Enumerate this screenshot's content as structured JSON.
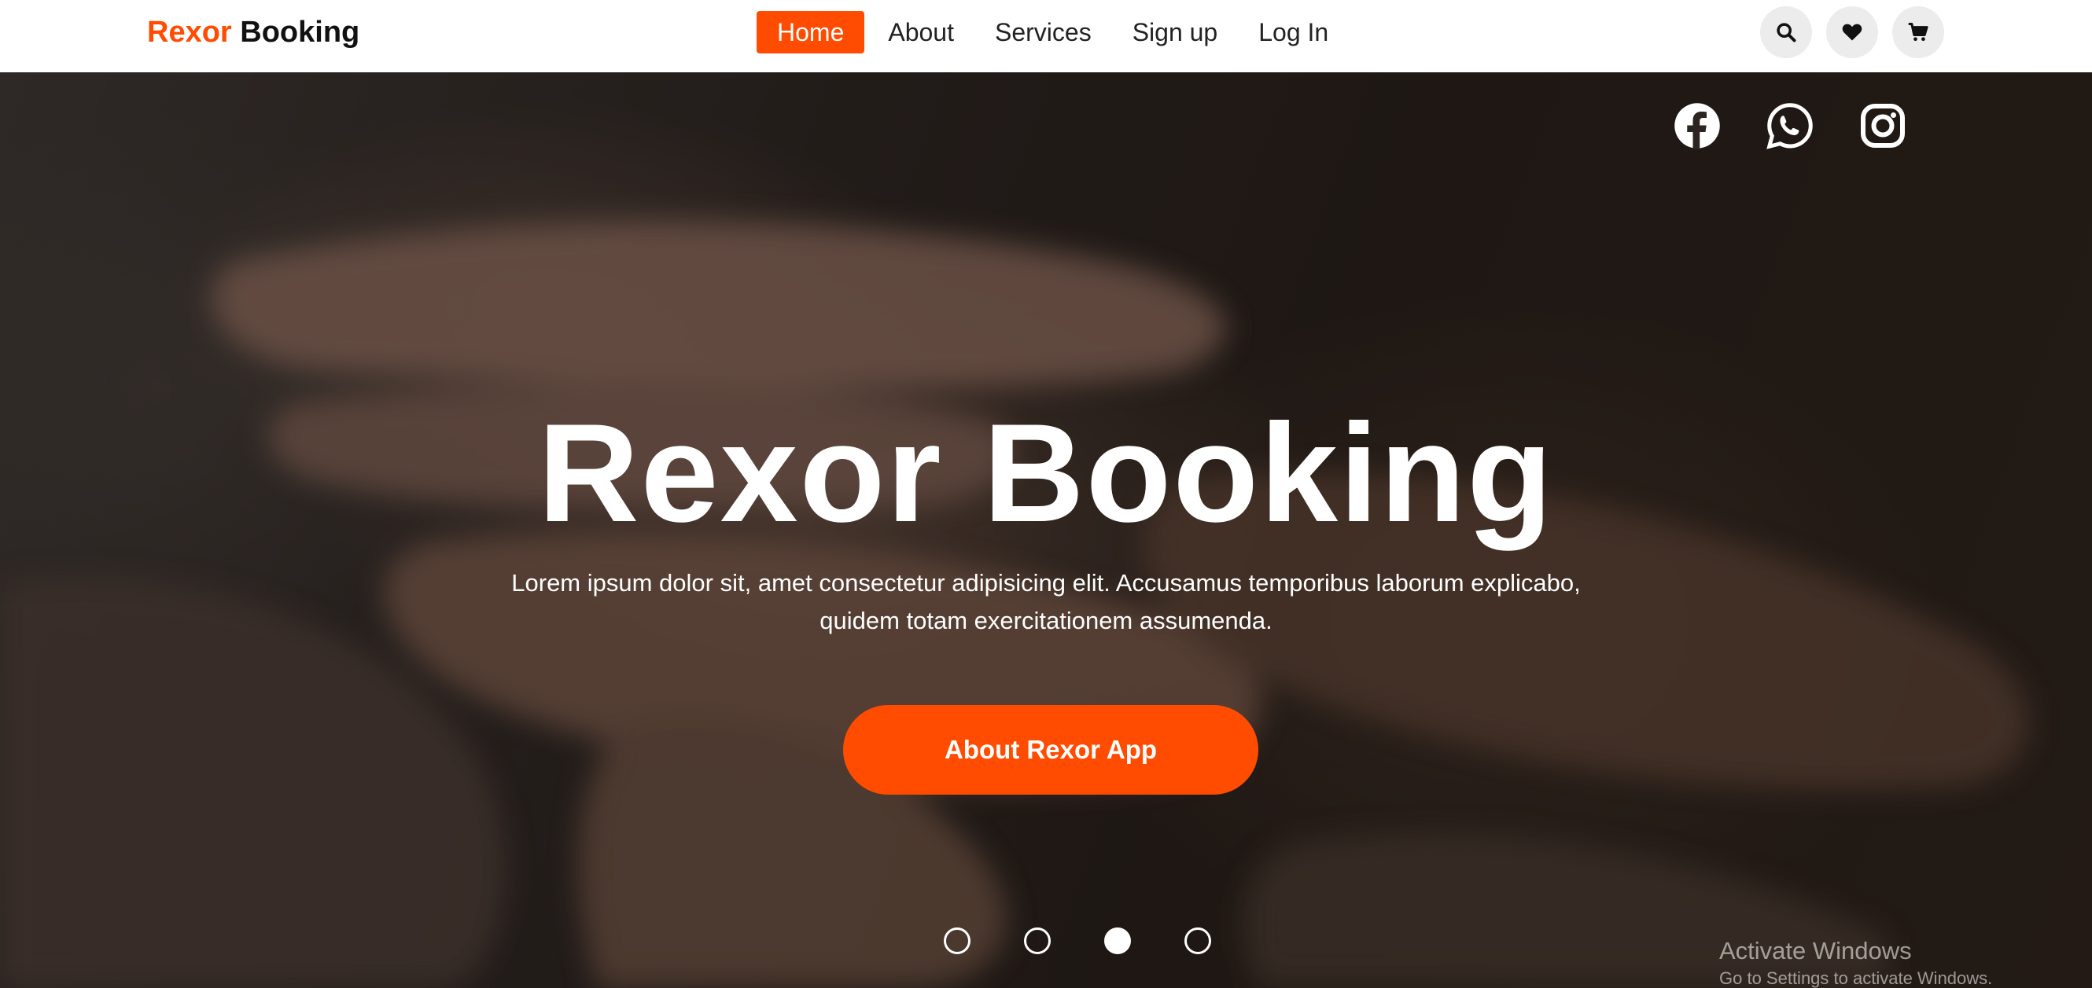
{
  "brand": {
    "accent": "Rexor",
    "rest": "Booking"
  },
  "nav": {
    "items": [
      {
        "label": "Home",
        "active": true
      },
      {
        "label": "About",
        "active": false
      },
      {
        "label": "Services",
        "active": false
      },
      {
        "label": "Sign up",
        "active": false
      },
      {
        "label": "Log In",
        "active": false
      }
    ],
    "icons": [
      "search-icon",
      "heart-icon",
      "cart-icon"
    ]
  },
  "hero": {
    "socials": [
      "facebook-icon",
      "whatsapp-icon",
      "instagram-icon"
    ],
    "title": "Rexor Booking",
    "subtitle_line1": "Lorem ipsum dolor sit, amet consectetur adipisicing elit. Accusamus temporibus laborum explicabo,",
    "subtitle_line2": "quidem totam exercitationem assumenda.",
    "cta": "About Rexor App",
    "slides": {
      "count": 4,
      "active_index": 2
    }
  },
  "watermark": {
    "line1": "Activate Windows",
    "line2": "Go to Settings to activate Windows."
  },
  "colors": {
    "accent": "#ff4c00",
    "nav_bg": "#ffffff",
    "icon_btn_bg": "#ececec"
  }
}
